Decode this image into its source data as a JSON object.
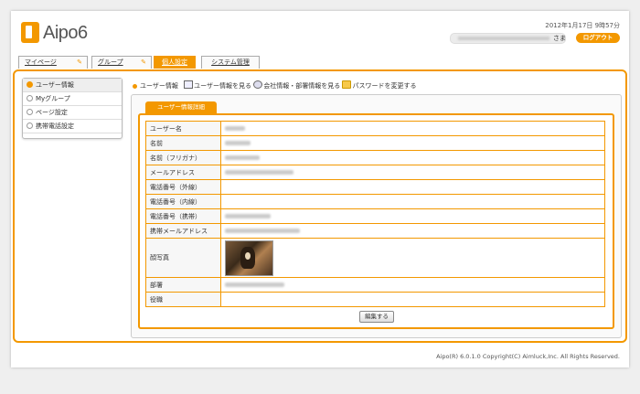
{
  "app": {
    "logo_text": "Aipo6",
    "datetime": "2012年1月17日 9時57分",
    "user_suffix": "さま",
    "logout_label": "ログアウト"
  },
  "tabs": [
    {
      "label": "マイページ",
      "active": false
    },
    {
      "label": "グループ",
      "active": false
    },
    {
      "label": "個人設定",
      "active": true
    },
    {
      "label": "システム管理",
      "active": false
    }
  ],
  "sidebar": {
    "items": [
      {
        "label": "ユーザー情報",
        "active": true
      },
      {
        "label": "Myグループ",
        "active": false
      },
      {
        "label": "ページ設定",
        "active": false
      },
      {
        "label": "携帯電話設定",
        "active": false
      }
    ]
  },
  "content_head": {
    "title": "ユーザー情報",
    "link_view_user": "ユーザー情報を見る",
    "link_view_company": "会社情報・部署情報を見る",
    "link_change_password": "パスワードを変更する"
  },
  "panel": {
    "tab_label": "ユーザー情報詳細",
    "rows": [
      {
        "label": "ユーザー名"
      },
      {
        "label": "名前"
      },
      {
        "label": "名前（フリガナ）"
      },
      {
        "label": "メールアドレス"
      },
      {
        "label": "電話番号（外線）"
      },
      {
        "label": "電話番号（内線）"
      },
      {
        "label": "電話番号（携帯）"
      },
      {
        "label": "携帯メールアドレス"
      },
      {
        "label": "顔写真"
      },
      {
        "label": "部署"
      },
      {
        "label": "役職"
      }
    ],
    "edit_label": "編集する"
  },
  "footer": {
    "text": "Aipo(R) 6.0.1.0 Copyright(C) Aimluck,Inc. All Rights Reserved."
  },
  "colors": {
    "accent": "#f39800"
  }
}
